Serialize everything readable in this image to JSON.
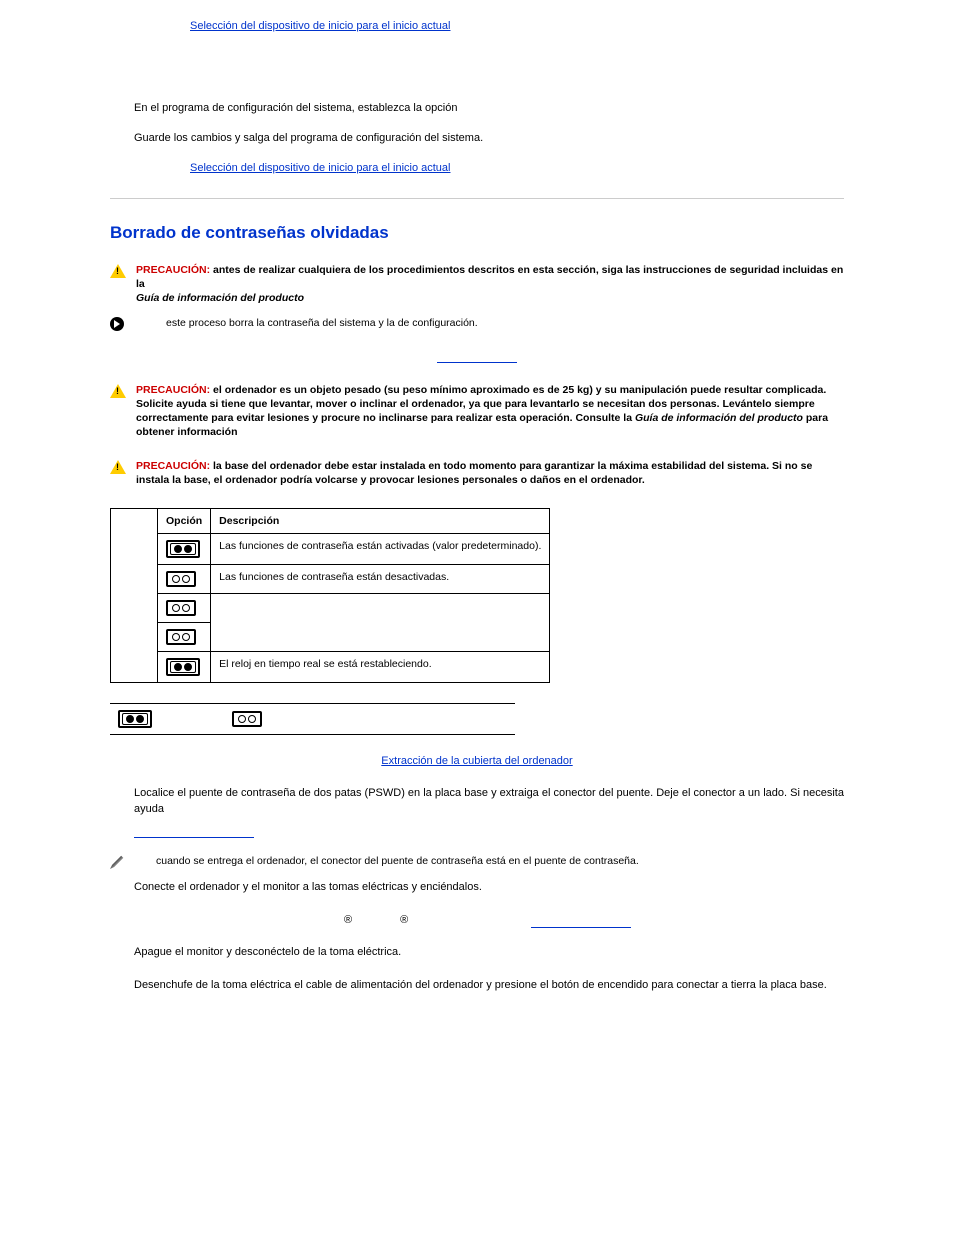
{
  "links": {
    "boot_sel_1": "Selección del dispositivo de inicio para el inicio actual",
    "boot_sel_2": "Selección del dispositivo de inicio para el inicio actual",
    "remove_cover": "Extracción de la cubierta del ordenador"
  },
  "paragraphs": {
    "p1": "En el programa de configuración del sistema, establezca la opción",
    "p2": "Guarde los cambios y salga del programa de configuración del sistema."
  },
  "section_title": "Borrado de contraseñas olvidadas",
  "warnings": {
    "w1_label": "PRECAUCIÓN: ",
    "w1_text": "antes de realizar cualquiera de los procedimientos descritos en esta sección, siga las instrucciones de seguridad incluidas en la ",
    "w1_em": "Guía de información del producto",
    "notice_label": "",
    "notice_text": "este proceso borra la contraseña del sistema y la de configuración.",
    "w2_label": "PRECAUCIÓN: ",
    "w2_text": "el ordenador es un objeto pesado (su peso mínimo aproximado es de 25 kg) y su manipulación puede resultar complicada. Solicite ayuda si tiene que levantar, mover o inclinar el ordenador, ya que para levantarlo se necesitan dos personas. Levántelo siempre correctamente para evitar lesiones y procure no inclinarse para realizar esta operación. Consulte la ",
    "w2_em": "Guía de información del producto",
    "w2_tail": " para obtener información",
    "w3_label": "PRECAUCIÓN: ",
    "w3_text": "la base del ordenador debe estar instalada en todo momento para garantizar la máxima estabilidad del sistema. Si no se instala la base, el ordenador podría volcarse y provocar lesiones personales o daños en el ordenador.",
    "note_text": "cuando se entrega el ordenador, el conector del puente de contraseña está en el puente de contraseña."
  },
  "table": {
    "h_opt": "Opción",
    "h_desc": "Descripción",
    "r1": "Las funciones de contraseña están activadas (valor predeterminado).",
    "r2": "Las funciones de contraseña están desactivadas.",
    "r3": "El reloj en tiempo real se está restableciendo."
  },
  "steps": {
    "s_locate": "Localice el puente de contraseña de dos patas (PSWD) en la placa base y extraiga el conector del puente. Deje el conector a un lado. Si necesita ayuda",
    "s_connect": "Conecte el ordenador y el monitor a las tomas eléctricas y enciéndalos.",
    "s_off_monitor": "Apague el monitor y desconéctelo de la toma eléctrica.",
    "s_unplug": "Desenchufe de la toma eléctrica el cable de alimentación del ordenador y presione el botón de encendido para conectar a tierra la placa base."
  }
}
